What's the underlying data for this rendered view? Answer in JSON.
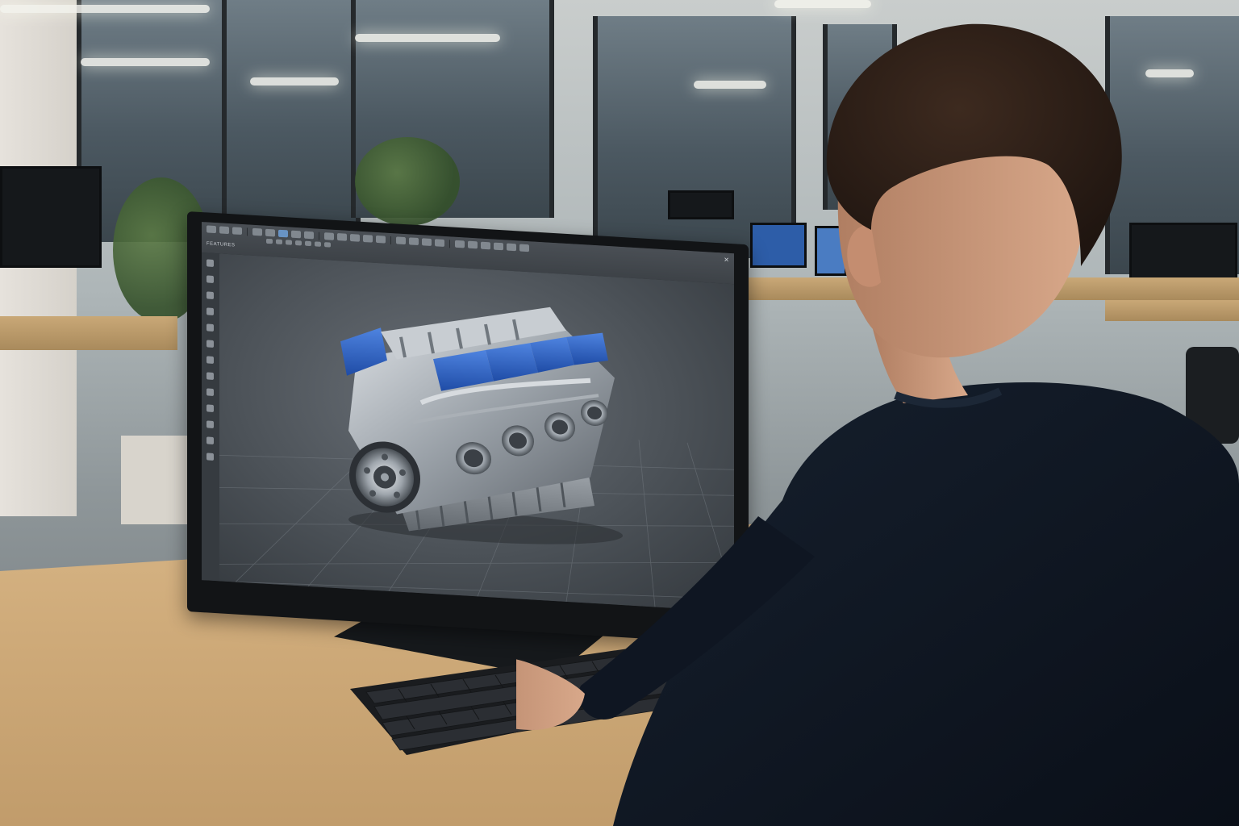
{
  "scene": {
    "description_kind": "photo",
    "software": {
      "toolbar_title": "FEATURES",
      "close_icon": "close-icon",
      "accent_color": "#3a6fcf",
      "viewport_background": "#4c5258",
      "model_highlight_color": "#2f5fbf"
    },
    "colors": {
      "desk": "#cfab7a",
      "sweater": "#0f1622",
      "hair": "#2a1d16",
      "skin": "#c9967a",
      "monitor_bezel": "#121416"
    }
  }
}
